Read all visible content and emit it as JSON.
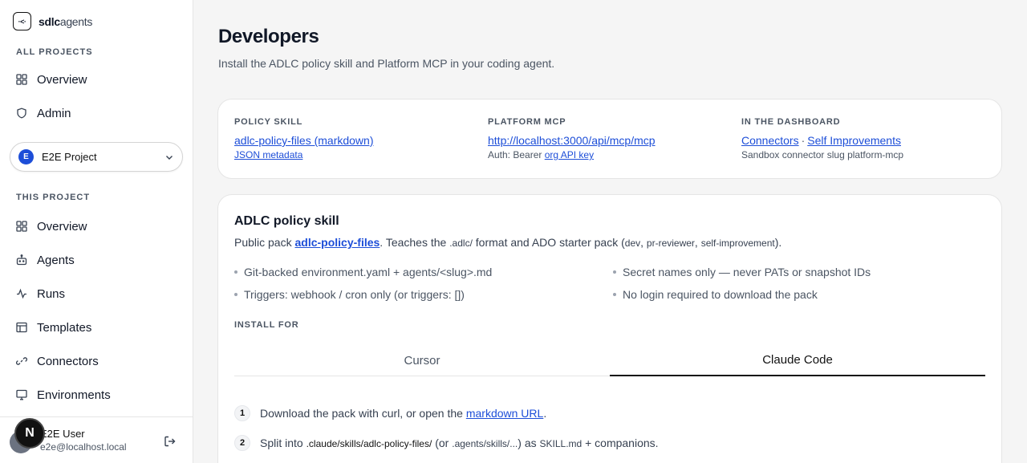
{
  "brand": {
    "part1": "sdlc",
    "part2": "agents",
    "logo_text": "·<·"
  },
  "sidebar": {
    "all_projects_label": "ALL PROJECTS",
    "all_items": [
      {
        "label": "Overview",
        "icon": "grid-icon"
      },
      {
        "label": "Admin",
        "icon": "shield-icon"
      }
    ],
    "project": {
      "badge": "E",
      "name": "E2E Project"
    },
    "this_project_label": "THIS PROJECT",
    "project_items": [
      {
        "label": "Overview",
        "icon": "grid-icon"
      },
      {
        "label": "Agents",
        "icon": "bot-icon"
      },
      {
        "label": "Runs",
        "icon": "activity-icon"
      },
      {
        "label": "Templates",
        "icon": "table-icon"
      },
      {
        "label": "Connectors",
        "icon": "link-icon"
      },
      {
        "label": "Environments",
        "icon": "monitor-icon"
      }
    ],
    "user": {
      "name": "E2E User",
      "email": "e2e@localhost.local"
    },
    "n_badge": "N"
  },
  "main": {
    "title": "Developers",
    "subtitle": "Install the ADLC policy skill and Platform MCP in your coding agent.",
    "summary": {
      "policy_skill": {
        "label": "POLICY SKILL",
        "link": "adlc-policy-files (markdown)",
        "sub_link": "JSON metadata"
      },
      "platform_mcp": {
        "label": "PLATFORM MCP",
        "link": "http://localhost:3000/api/mcp/mcp",
        "sub_prefix": "Auth: Bearer",
        "sub_link": "org API key"
      },
      "dashboard": {
        "label": "IN THE DASHBOARD",
        "link1": "Connectors",
        "sep": "·",
        "link2": "Self Improvements",
        "sub": "Sandbox connector slug platform-mcp"
      }
    },
    "skill": {
      "title": "ADLC policy skill",
      "desc_prefix": "Public pack",
      "desc_link": "adlc-policy-files",
      "desc_mid1": ". Teaches the",
      "desc_code1": ".adlc/",
      "desc_mid2": "format and ADO starter pack (",
      "desc_code2": "dev",
      "desc_comma1": ",",
      "desc_code3": "pr-reviewer",
      "desc_comma2": ",",
      "desc_code4": "self-improvement",
      "desc_end": ").",
      "bullets": [
        "Git-backed environment.yaml + agents/<slug>.md",
        "Triggers: webhook / cron only (or triggers: [])",
        "Secret names only — never PATs or snapshot IDs",
        "No login required to download the pack"
      ],
      "install_label": "INSTALL FOR",
      "tabs": [
        "Cursor",
        "Claude Code"
      ],
      "active_tab": "Claude Code",
      "steps": [
        {
          "num": "1",
          "text": "Download the pack with curl, or open the",
          "link": "markdown URL",
          "end": "."
        },
        {
          "num": "2",
          "text": "Split into",
          "code1": ".claude/skills/adlc-policy-files/",
          "mid": "(or",
          "code2": ".agents/skills/...",
          "mid2": ") as",
          "code3": "SKILL.md",
          "end": "+ companions."
        }
      ]
    }
  }
}
